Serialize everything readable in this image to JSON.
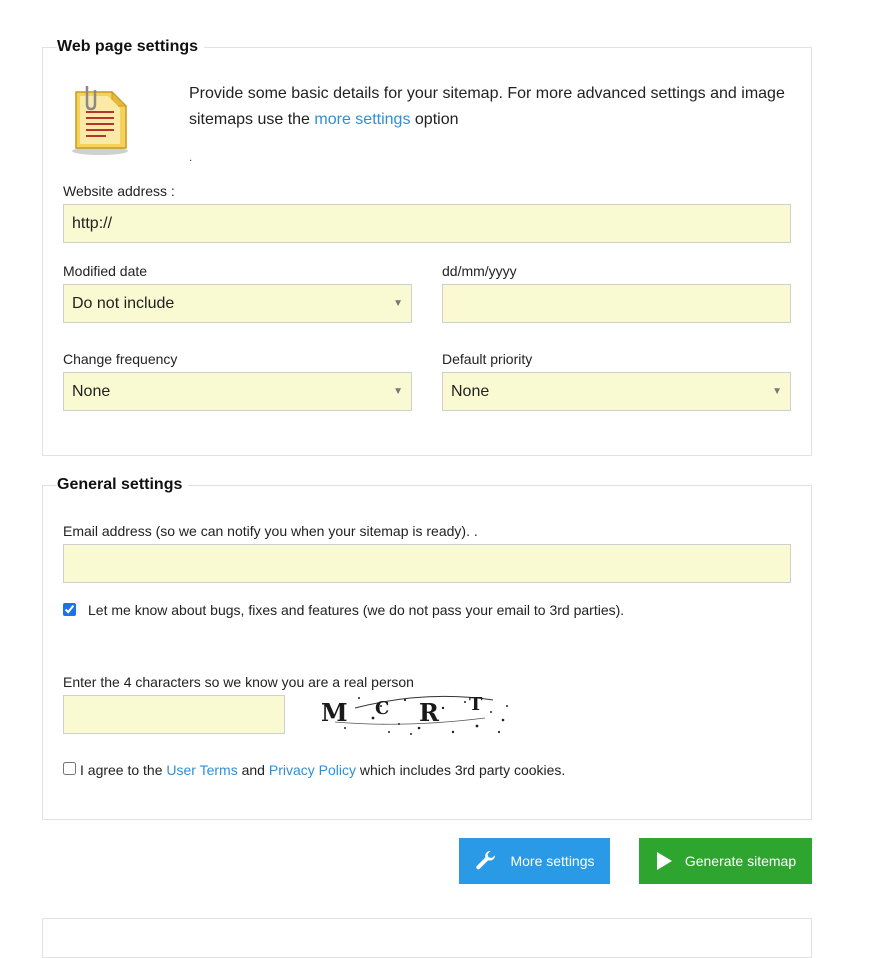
{
  "web_settings": {
    "title": "Web page settings",
    "intro_part1": "Provide some basic details for your sitemap. For more advanced settings and image sitemaps use the ",
    "intro_link": "more settings",
    "intro_part2": " option",
    "dot": ".",
    "website_label": "Website address :",
    "website_value": "http://",
    "modified_label": "Modified date",
    "modified_value": "Do not include",
    "date_label": "dd/mm/yyyy",
    "date_value": "",
    "frequency_label": "Change frequency",
    "frequency_value": "None",
    "priority_label": "Default priority",
    "priority_value": "None"
  },
  "general_settings": {
    "title": "General settings",
    "email_label": "Email address (so we can notify you when your sitemap is ready). .",
    "email_value": "",
    "notify_label": "Let me know about bugs, fixes and features (we do not pass your email to 3rd parties).",
    "notify_checked": true,
    "captcha_label": "Enter the 4 characters so we know you are a real person",
    "captcha_value": "",
    "captcha_chars": [
      "M",
      "C",
      "R",
      "T"
    ],
    "agree_prefix": "I agree to the ",
    "agree_terms": "User Terms",
    "agree_and": " and ",
    "agree_privacy": "Privacy Policy",
    "agree_suffix": " which includes 3rd party cookies.",
    "agree_checked": false
  },
  "buttons": {
    "more_settings": "More settings",
    "generate": "Generate sitemap"
  },
  "colors": {
    "field_bg": "#fafad2",
    "link": "#2e8fd6",
    "more_button": "#2b9ae6",
    "generate_button": "#2ea52e"
  },
  "icons": {
    "document": "document-with-paperclip-icon",
    "wrench": "wrench-icon",
    "play": "play-icon"
  }
}
